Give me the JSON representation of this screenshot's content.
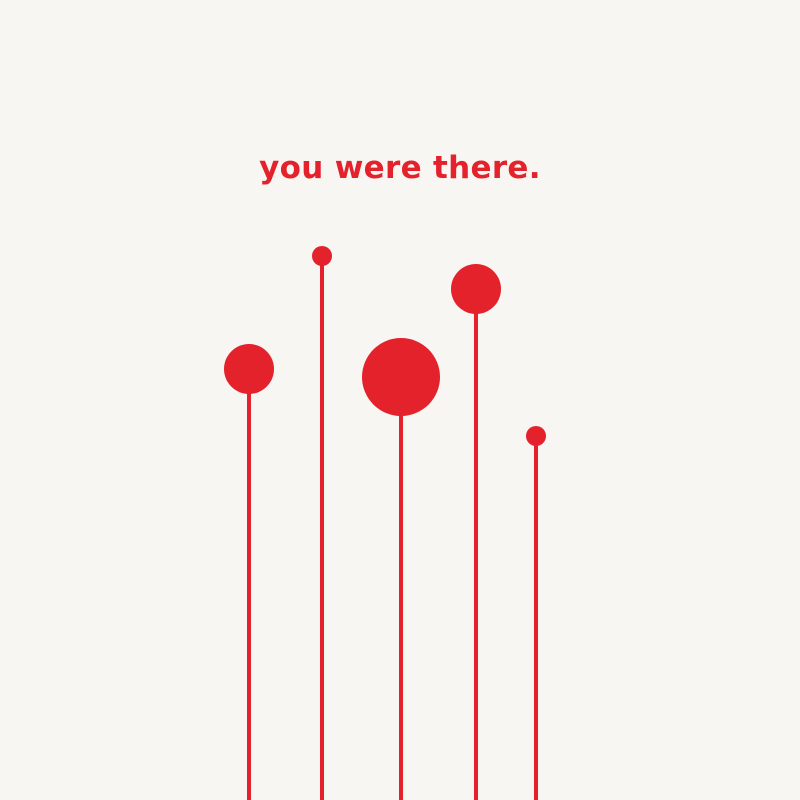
{
  "poster": {
    "headline": "you were there.",
    "colors": {
      "background": "#f8f6f2",
      "accent": "#e3222c"
    },
    "pins_count": 5
  }
}
